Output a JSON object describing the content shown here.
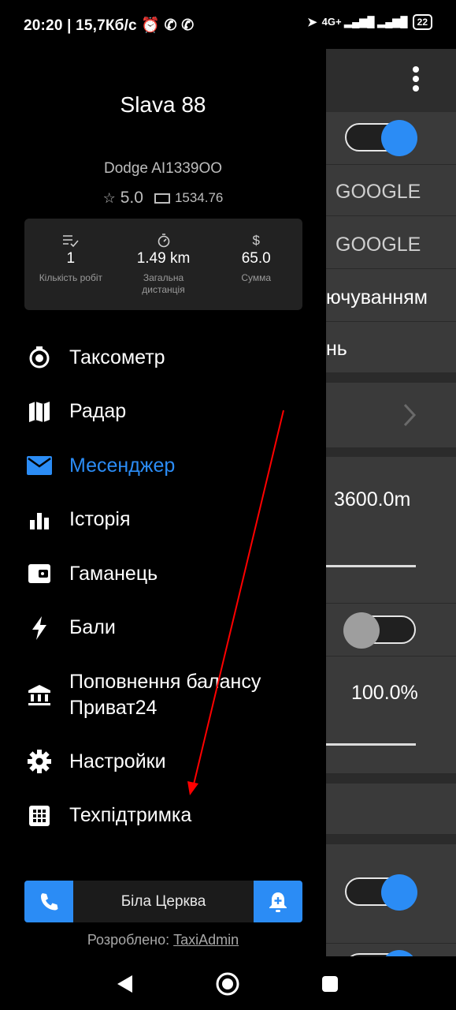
{
  "status_bar": {
    "time": "20:20 | 15,7Кб/с ⏰ ✆ ✆",
    "right": "4G+ ▂▄▆█ ▂▄▆█",
    "battery": "22"
  },
  "profile": {
    "name": "Slava 88",
    "car": "Dodge AI1339OO",
    "rating": "5.0",
    "balance": "1534.76"
  },
  "stats": [
    {
      "value": "1",
      "label": "Кількість робіт"
    },
    {
      "value": "1.49 km",
      "label": "Загальна дистанція"
    },
    {
      "value": "65.0",
      "label": "Сумма"
    }
  ],
  "menu": [
    {
      "label": "Таксометр",
      "icon": "taximeter-icon"
    },
    {
      "label": "Радар",
      "icon": "map-icon"
    },
    {
      "label": "Месенджер",
      "icon": "mail-icon",
      "active": true
    },
    {
      "label": "Історія",
      "icon": "bar-chart-icon"
    },
    {
      "label": "Гаманець",
      "icon": "wallet-icon"
    },
    {
      "label": "Бали",
      "icon": "lightning-icon"
    },
    {
      "label": "Поповнення балансу Приват24",
      "icon": "bank-icon"
    },
    {
      "label": "Настройки",
      "icon": "gear-icon"
    },
    {
      "label": "Техпідтримка",
      "icon": "grid-icon"
    }
  ],
  "bottom_bar": {
    "city": "Біла Церква"
  },
  "developer": {
    "prefix": "Розроблено:",
    "link": "TaxiAdmin"
  },
  "background": {
    "google_1": "GOOGLE",
    "google_2": "GOOGLE",
    "text_1": "ючуванням",
    "text_2": "нь",
    "distance": "3600.0m",
    "percent": "100.0%"
  },
  "colors": {
    "accent": "#2b8cf5",
    "annotation_arrow": "#ff0000"
  }
}
